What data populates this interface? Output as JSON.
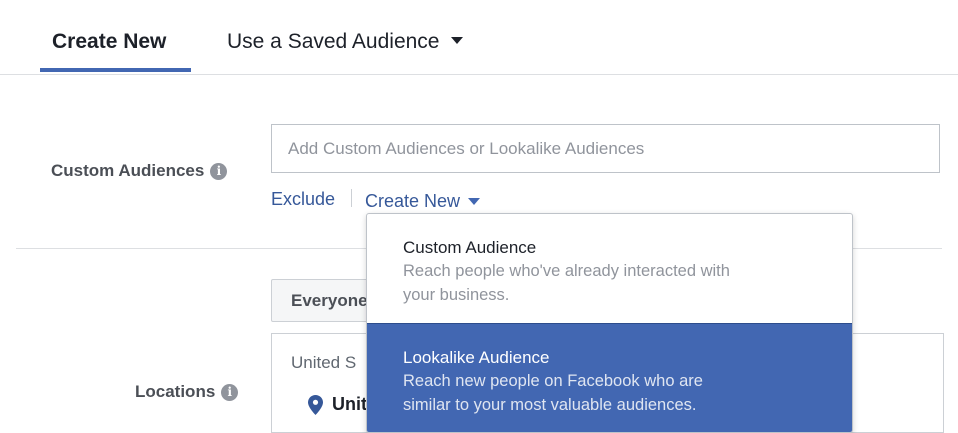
{
  "tabs": {
    "create_new": "Create New",
    "saved_audience": "Use a Saved Audience"
  },
  "custom_audiences": {
    "label": "Custom Audiences",
    "info": "i",
    "placeholder": "Add Custom Audiences or Lookalike Audiences",
    "value": "",
    "exclude": "Exclude",
    "create_new": "Create New"
  },
  "dropdown": {
    "items": [
      {
        "title": "Custom Audience",
        "desc_line1": "Reach people who've already interacted with",
        "desc_line2": "your business.",
        "selected": false
      },
      {
        "title": "Lookalike Audience",
        "desc_line1": "Reach new people on Facebook who are",
        "desc_line2": "similar to your most valuable audiences.",
        "selected": true
      }
    ]
  },
  "locations": {
    "label": "Locations",
    "info": "i",
    "filter_button": "Everyone",
    "country": "United S",
    "item": "Unit"
  },
  "colors": {
    "accent": "#4267b2",
    "link": "#365899",
    "selected_bg": "#4267b2"
  }
}
